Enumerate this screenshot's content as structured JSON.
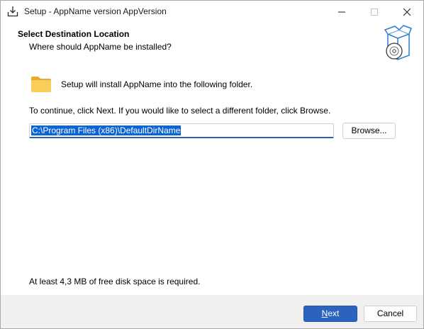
{
  "window": {
    "title": "Setup - AppName version AppVersion",
    "icons": [
      "download-icon",
      "minimize-icon",
      "maximize-icon",
      "close-icon"
    ]
  },
  "header": {
    "title": "Select Destination Location",
    "subtitle": "Where should AppName be installed?",
    "image_icon": "setup-box-disc-icon"
  },
  "content": {
    "folder_icon": "folder-icon",
    "install_text": "Setup will install AppName into the following folder.",
    "continue_text": "To continue, click Next. If you would like to select a different folder, click Browse.",
    "path_value": "C:\\Program Files (x86)\\DefaultDirName",
    "browse_label": "Browse...",
    "space_text": "At least 4,3 MB of free disk space is required."
  },
  "footer": {
    "next_label": "Next",
    "cancel_label": "Cancel"
  },
  "colors": {
    "accent": "#2b63bf",
    "selection": "#0a64d6",
    "folder": "#f6c342"
  }
}
